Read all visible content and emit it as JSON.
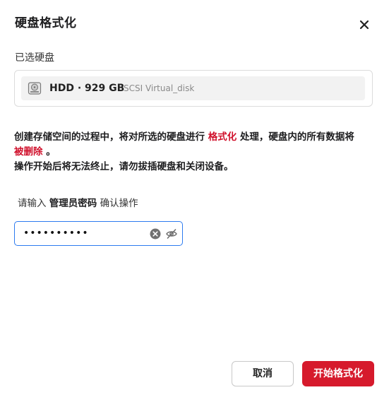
{
  "dialog": {
    "title": "硬盘格式化",
    "close_icon": "close-icon"
  },
  "selected_disk": {
    "label": "已选硬盘",
    "icon": "hard-drive-icon",
    "name": "HDD · 929 GB",
    "description": "SCSI  Virtual_disk"
  },
  "warning": {
    "line1_part1": "创建存储空间的过程中，将对所选的硬盘进行 ",
    "line1_highlight": "格式化",
    "line1_part2": " 处理，硬盘内的所有数据将",
    "line2_highlight": "被删除",
    "line2_end": " 。",
    "line3": "操作开始后将无法终止，请勿拔插硬盘和关闭设备。"
  },
  "password_prompt": {
    "prefix": "请输入 ",
    "bold": "管理员密码",
    "suffix": " 确认操作"
  },
  "password_field": {
    "value": "••••••••••",
    "clear_icon": "clear-icon",
    "visibility_icon": "eye-off-icon"
  },
  "buttons": {
    "cancel": "取消",
    "start": "开始格式化"
  },
  "colors": {
    "accent_red": "#d61a2c",
    "focus_blue": "#2d7bf0"
  }
}
